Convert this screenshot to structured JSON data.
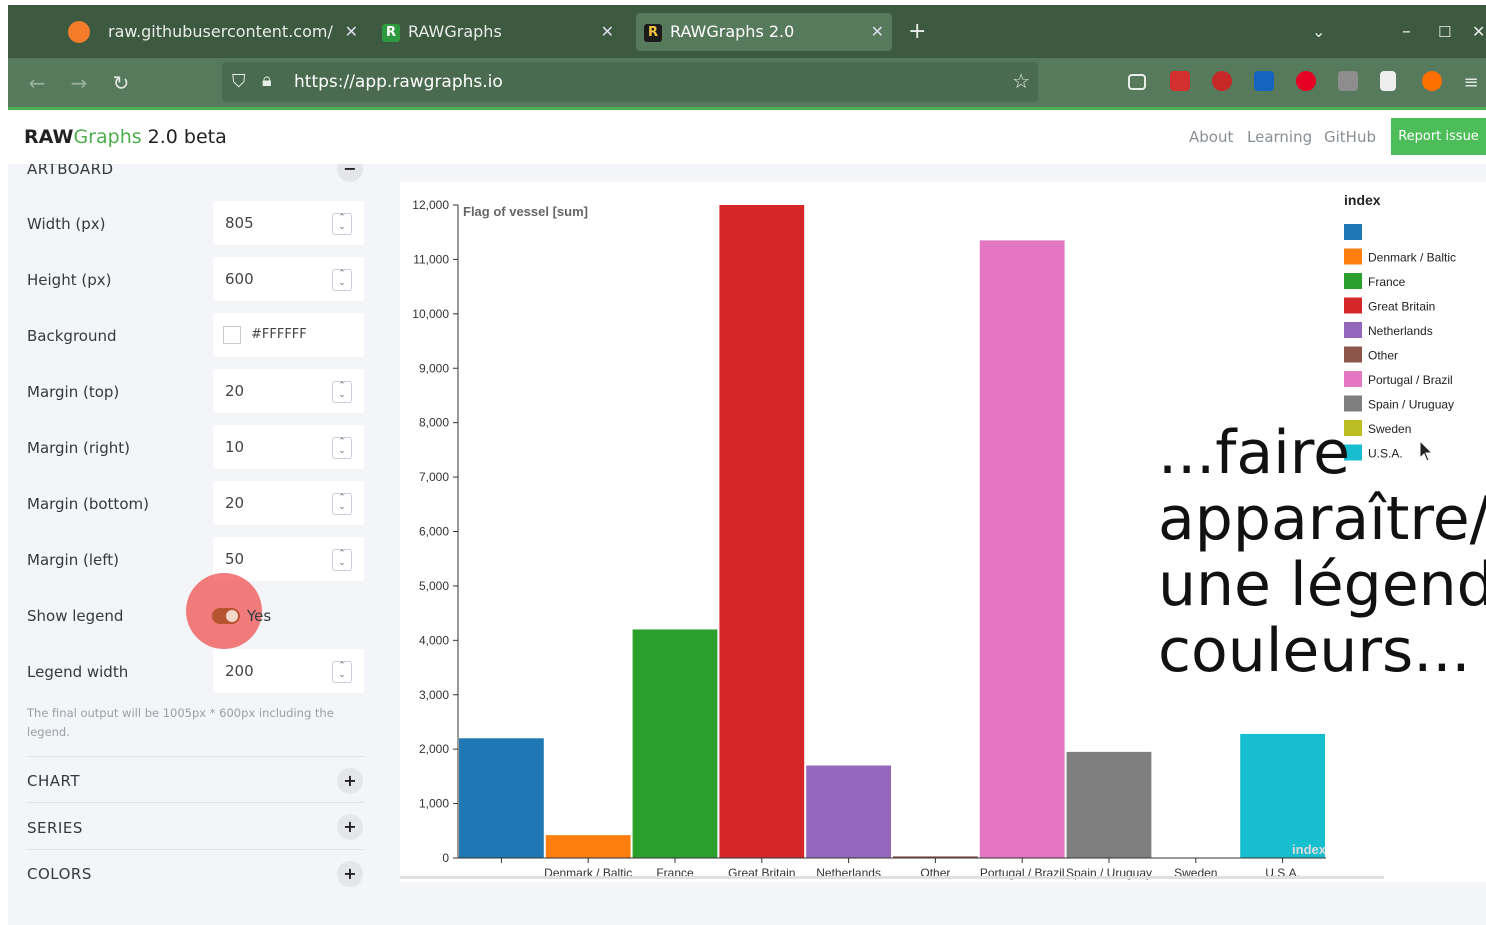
{
  "browser": {
    "tabs": [
      {
        "title": "raw.githubusercontent.com/",
        "icon": "document-icon"
      },
      {
        "title": "RAWGraphs",
        "icon": "rawgraphs-icon"
      },
      {
        "title": "RAWGraphs 2.0",
        "icon": "rawgraphs-icon"
      }
    ],
    "new_tab": "+",
    "url": "https://app.rawgraphs.io"
  },
  "app": {
    "logo_raw": "RAW",
    "logo_graphs": "Graphs",
    "logo_version": " 2.0 beta",
    "nav": [
      "About",
      "Learning",
      "GitHub"
    ],
    "report": "Report issue"
  },
  "sidebar": {
    "section_artboard": "ARTBOARD",
    "fields": [
      {
        "label": "Width (px)",
        "value": "805"
      },
      {
        "label": "Height (px)",
        "value": "600"
      },
      {
        "label": "Background",
        "value": "#FFFFFF"
      },
      {
        "label": "Margin (top)",
        "value": "20"
      },
      {
        "label": "Margin (right)",
        "value": "10"
      },
      {
        "label": "Margin (bottom)",
        "value": "20"
      },
      {
        "label": "Margin (left)",
        "value": "50"
      },
      {
        "label": "Show legend",
        "value": "Yes"
      },
      {
        "label": "Legend width",
        "value": "200"
      }
    ],
    "note": "The final output will be 1005px * 600px including the legend.",
    "sections": [
      "CHART",
      "SERIES",
      "COLORS"
    ]
  },
  "overlay_text": [
    "...faire",
    "apparaître/d",
    "une légende",
    "couleurs..."
  ],
  "chart_data": {
    "type": "bar",
    "ylabel": "Flag of vessel [sum]",
    "xlabel": "index",
    "ylim": [
      0,
      12000
    ],
    "yticks": [
      "0",
      "1,000",
      "2,000",
      "3,000",
      "4,000",
      "5,000",
      "6,000",
      "7,000",
      "8,000",
      "9,000",
      "10,000",
      "11,000",
      "12,000"
    ],
    "categories": [
      "",
      "Denmark / Baltic",
      "France",
      "Great Britain",
      "Netherlands",
      "Other",
      "Portugal / Brazil",
      "Spain / Uruguay",
      "Sweden",
      "U.S.A."
    ],
    "values": [
      2200,
      420,
      4200,
      12000,
      1700,
      30,
      11350,
      1950,
      0,
      2280
    ],
    "colors": [
      "#1f77b4",
      "#ff7f0e",
      "#2ca02c",
      "#d62728",
      "#9467bd",
      "#8c564b",
      "#e377c2",
      "#7f7f7f",
      "#bcbd22",
      "#17becf"
    ],
    "legend": {
      "title": "index",
      "items": [
        "",
        "Denmark / Baltic",
        "France",
        "Great Britain",
        "Netherlands",
        "Other",
        "Portugal / Brazil",
        "Spain / Uruguay",
        "Sweden",
        "U.S.A."
      ]
    }
  }
}
